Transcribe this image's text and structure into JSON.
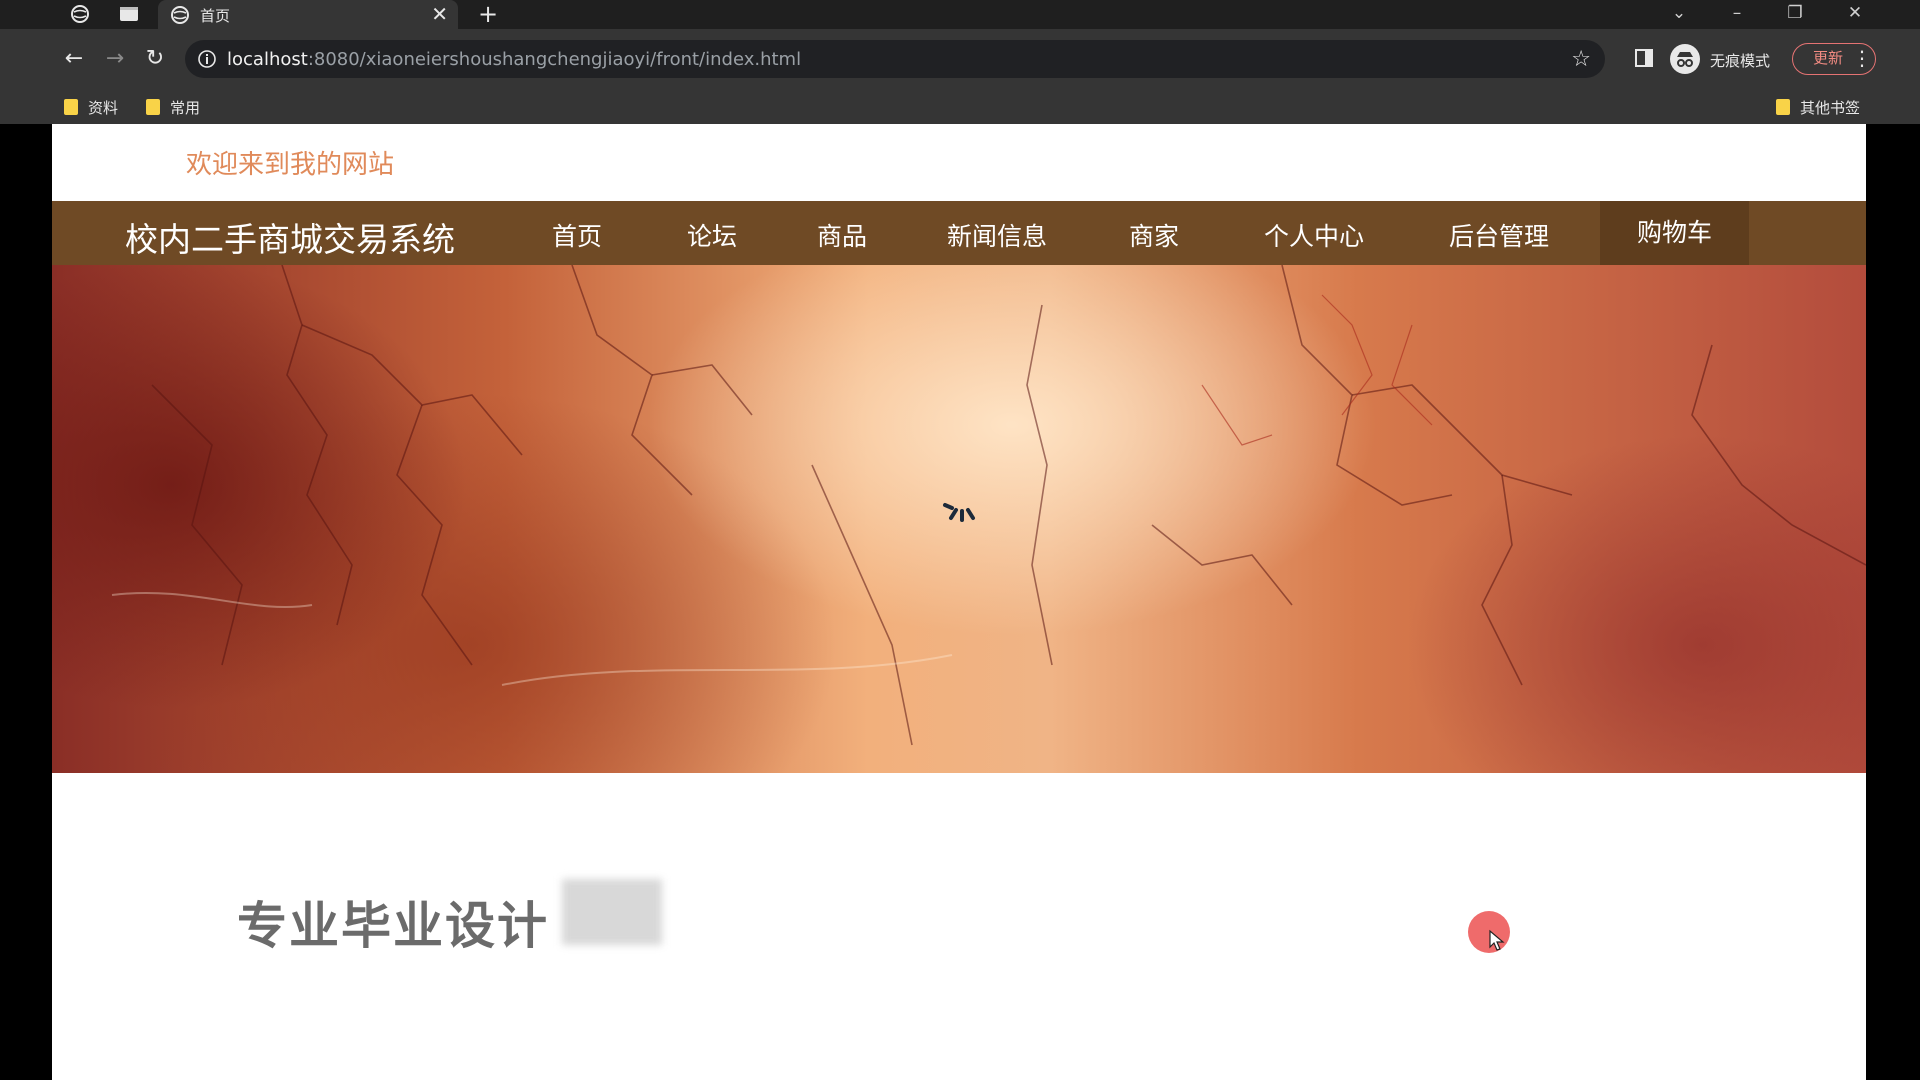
{
  "browser": {
    "tab_title": "首页",
    "url_host": "localhost",
    "url_rest": ":8080/xiaoneiershoushangchengjiaoyi/front/index.html",
    "incognito_label": "无痕模式",
    "update_label": "更新",
    "bookmarks": [
      "资料",
      "常用"
    ],
    "other_bookmarks": "其他书签"
  },
  "page": {
    "welcome": "欢迎来到我的网站",
    "site_title": "校内二手商城交易系统",
    "nav": [
      "首页",
      "论坛",
      "商品",
      "新闻信息",
      "商家",
      "个人中心",
      "后台管理",
      "购物车"
    ],
    "headline": "专业毕业设计"
  },
  "colors": {
    "navbar": "#6f4a25",
    "welcome_text": "#e08a5a",
    "cursor_dot": "#ef6b6b"
  }
}
